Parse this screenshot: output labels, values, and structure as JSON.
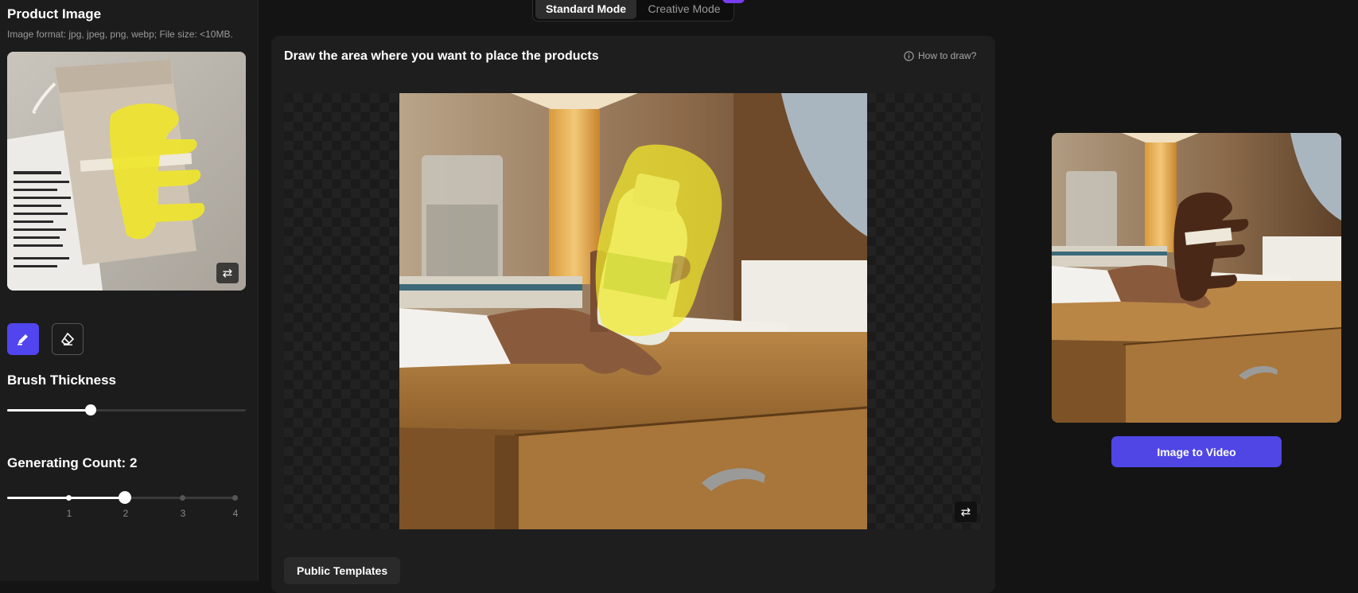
{
  "left_panel": {
    "product_image_title": "Product Image",
    "format_hint": "Image format: jpg, jpeg, png, webp; File size: <10MB.",
    "brush_thickness_title": "Brush Thickness",
    "brush_thickness_value": 0.35,
    "generating_count_title": "Generating Count: 2",
    "generating_count": {
      "value": 2,
      "ticks": [
        "1",
        "2",
        "3",
        "4"
      ]
    }
  },
  "mode_switch": {
    "standard": "Standard Mode",
    "creative": "Creative Mode",
    "active": "Standard Mode"
  },
  "canvas_card": {
    "title": "Draw the area where you want to place the products",
    "how_to_draw": "How to draw?"
  },
  "templates_button": "Public Templates",
  "result": {
    "video_button": "Image to Video"
  },
  "colors": {
    "accent": "#5145f0",
    "mask": "#f2ea2a",
    "video_button": "#4f46e5"
  },
  "icons": [
    "info-icon",
    "swap-icon",
    "brush-icon",
    "eraser-icon"
  ]
}
